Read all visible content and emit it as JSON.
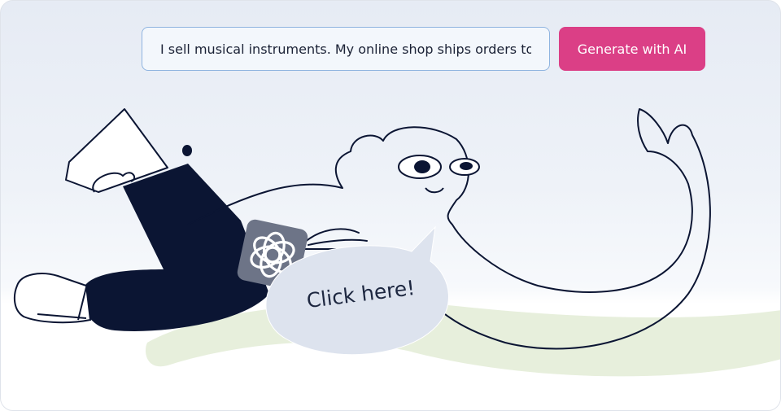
{
  "prompt": {
    "value": "I sell musical instruments. My online shop ships orders to",
    "placeholder": ""
  },
  "generate_button": {
    "label": "Generate with AI"
  },
  "speech_bubble": {
    "text": "Click here!"
  },
  "colors": {
    "accent": "#db3f86",
    "ink": "#0b1533",
    "input_border": "#8fb4e0",
    "bubble": "#dde3ee",
    "ground": "#e7efdc"
  },
  "icons": [
    "openai-logo-icon"
  ]
}
